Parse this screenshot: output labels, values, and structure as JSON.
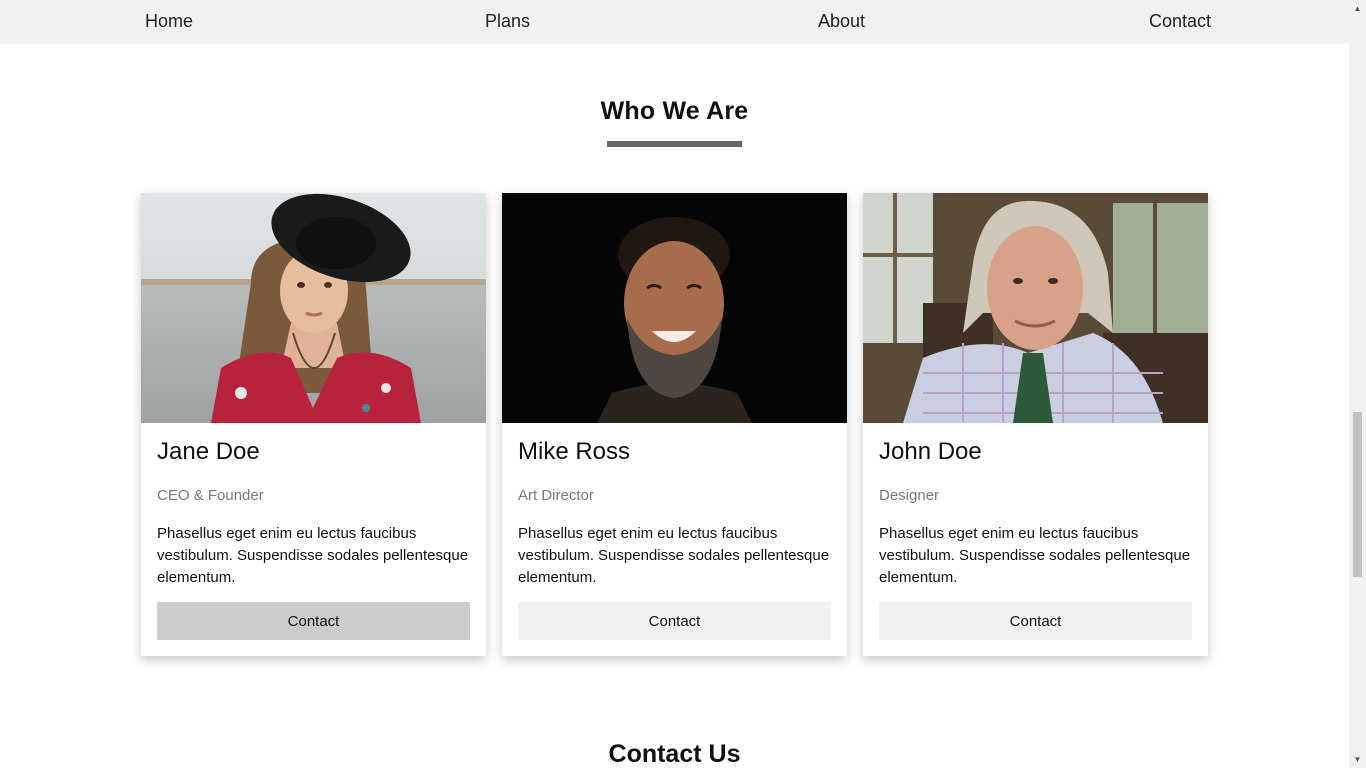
{
  "nav": {
    "items": [
      "Home",
      "Plans",
      "About",
      "Contact"
    ]
  },
  "team_section": {
    "title": "Who We Are"
  },
  "cards": [
    {
      "name": "Jane Doe",
      "role": "CEO & Founder",
      "description": "Phasellus eget enim eu lectus faucibus vestibulum. Suspendisse sodales pellentesque elementum.",
      "button_label": "Contact"
    },
    {
      "name": "Mike Ross",
      "role": "Art Director",
      "description": "Phasellus eget enim eu lectus faucibus vestibulum. Suspendisse sodales pellentesque elementum.",
      "button_label": "Contact"
    },
    {
      "name": "John Doe",
      "role": "Designer",
      "description": "Phasellus eget enim eu lectus faucibus vestibulum. Suspendisse sodales pellentesque elementum.",
      "button_label": "Contact"
    }
  ],
  "contact_section": {
    "title": "Contact Us"
  },
  "colors": {
    "nav_bg": "#f1f1f1",
    "underline": "#666666",
    "button_bg": "#f1f1f1",
    "button_hover_bg": "#cccccc",
    "role_text": "#777777"
  }
}
